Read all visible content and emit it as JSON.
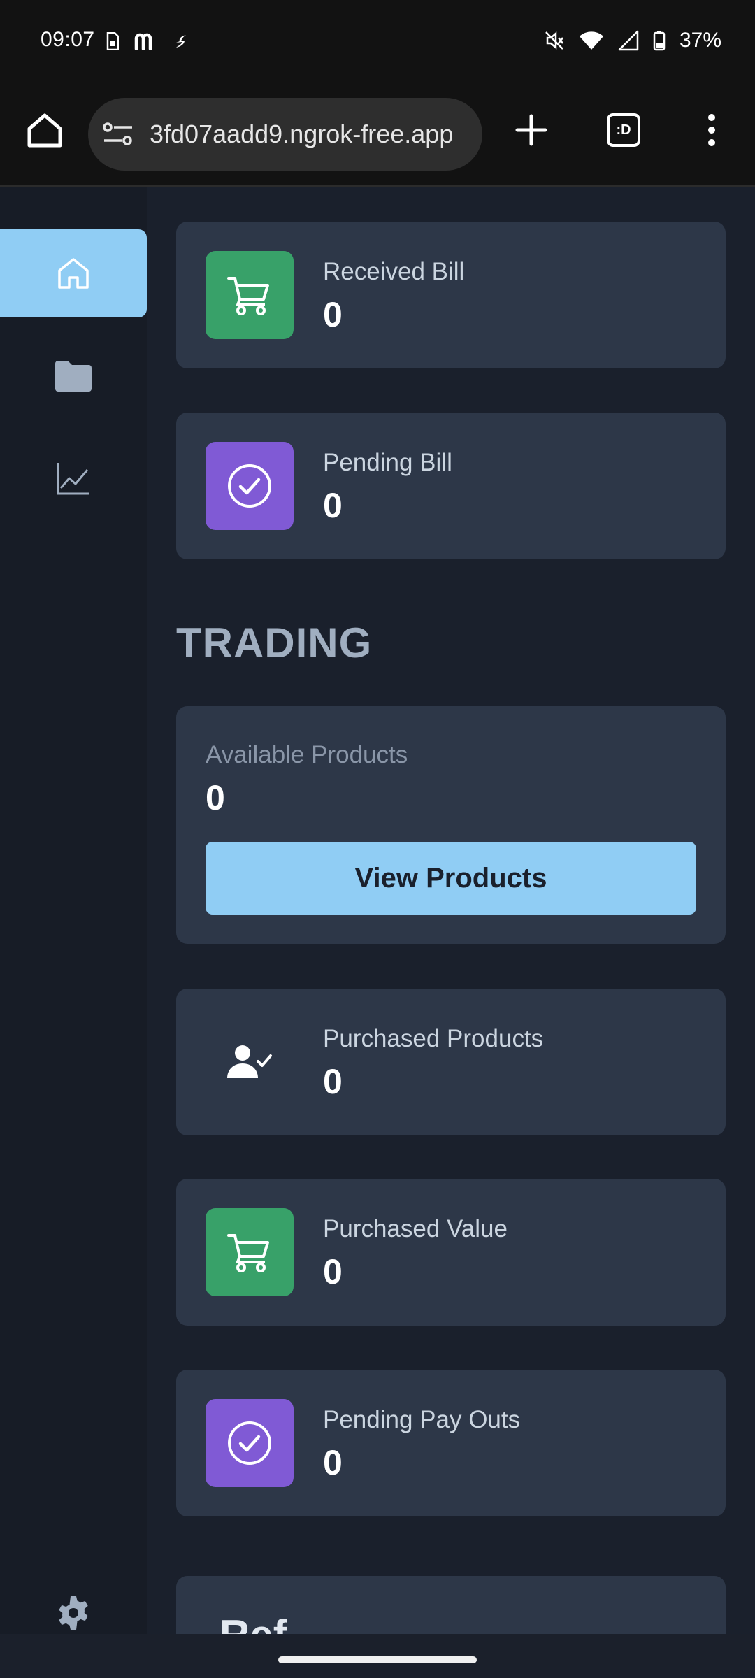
{
  "status_bar": {
    "time": "09:07",
    "battery": "37%"
  },
  "browser": {
    "url": "3fd07aadd9.ngrok-free.app",
    "tabs_label": ":D"
  },
  "sidebar": {
    "items": [
      {
        "name": "home",
        "icon": "home-icon",
        "active": true
      },
      {
        "name": "folder",
        "icon": "folder-icon",
        "active": false
      },
      {
        "name": "analytics",
        "icon": "chart-line-icon",
        "active": false
      },
      {
        "name": "settings",
        "icon": "gear-icon",
        "active": false
      }
    ]
  },
  "cards": {
    "received_bill": {
      "label": "Received Bill",
      "value": "0",
      "icon": "cart-icon",
      "color": "#38a169"
    },
    "pending_bill": {
      "label": "Pending Bill",
      "value": "0",
      "icon": "check-circle-icon",
      "color": "#805ad5"
    }
  },
  "trading": {
    "title": "TRADING",
    "available_products": {
      "label": "Available Products",
      "value": "0",
      "button_label": "View Products"
    },
    "purchased_products": {
      "label": "Purchased Products",
      "value": "0",
      "icon": "user-check-icon"
    },
    "purchased_value": {
      "label": "Purchased Value",
      "value": "0",
      "icon": "cart-icon",
      "color": "#38a169"
    },
    "pending_payouts": {
      "label": "Pending Pay Outs",
      "value": "0",
      "icon": "check-circle-icon",
      "color": "#805ad5"
    }
  },
  "next_section": {
    "partial_title": "Ref"
  },
  "colors": {
    "accent": "#90cdf4",
    "background": "#1a202c",
    "card": "#2d3748"
  }
}
